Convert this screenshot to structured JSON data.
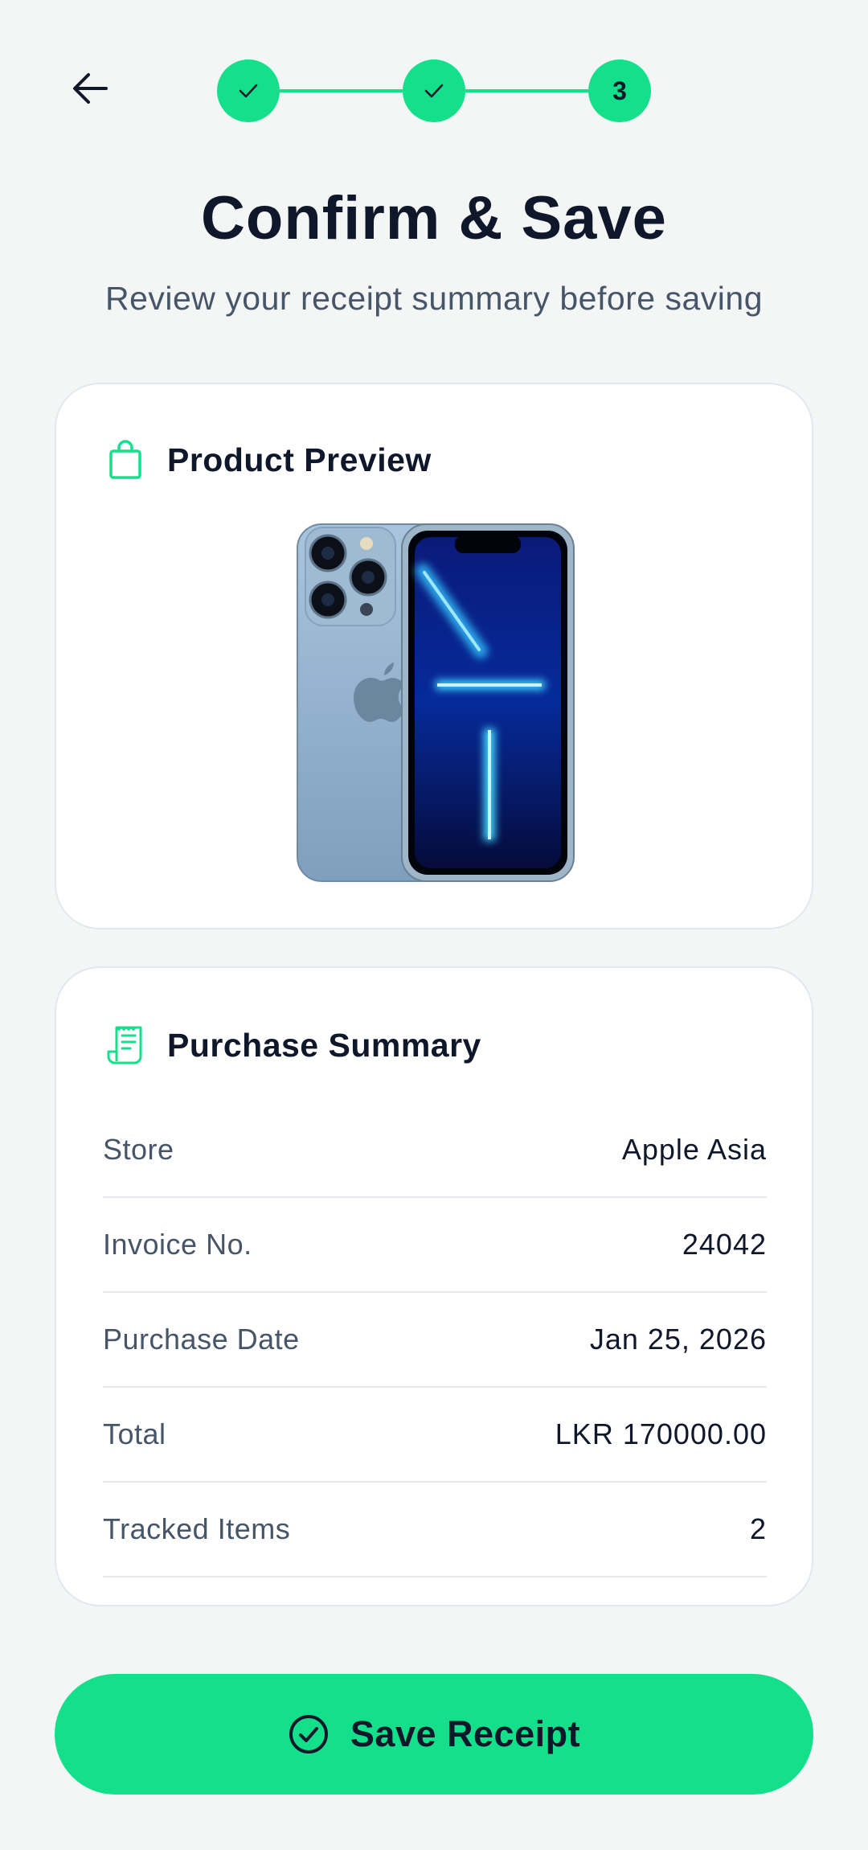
{
  "header": {
    "back_icon": "arrow-left-icon",
    "steps": [
      {
        "state": "done",
        "icon": "check-icon"
      },
      {
        "state": "done",
        "icon": "check-icon"
      },
      {
        "state": "current",
        "label": "3"
      }
    ],
    "title": "Confirm & Save",
    "subtitle": "Review your receipt summary before saving"
  },
  "preview_card": {
    "icon": "shopping-bag-icon",
    "title": "Product Preview",
    "image": "iphone-product-image"
  },
  "summary_card": {
    "icon": "receipt-icon",
    "title": "Purchase Summary",
    "rows": [
      {
        "label": "Store",
        "value": "Apple Asia"
      },
      {
        "label": "Invoice No.",
        "value": "24042"
      },
      {
        "label": "Purchase Date",
        "value": "Jan 25, 2026"
      },
      {
        "label": "Total",
        "value": "LKR 170000.00"
      },
      {
        "label": "Tracked Items",
        "value": "2"
      }
    ]
  },
  "actions": {
    "save_icon": "check-circle-icon",
    "save_label": "Save Receipt"
  },
  "colors": {
    "accent": "#14e08c",
    "background": "#f4f6f6",
    "text_primary": "#0f172a",
    "text_secondary": "#475569"
  }
}
